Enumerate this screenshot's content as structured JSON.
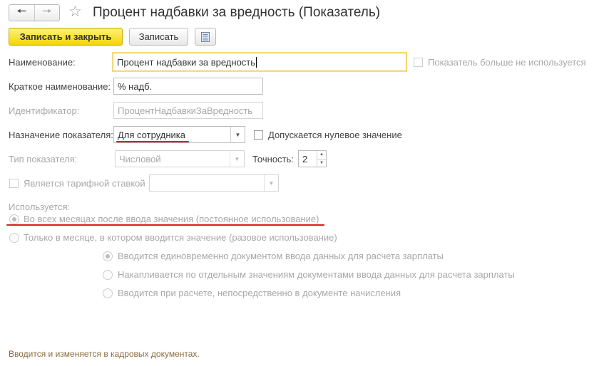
{
  "header": {
    "back_icon": "arrow-left-icon",
    "forward_icon": "arrow-right-icon",
    "favorite_icon": "star-icon",
    "title": "Процент надбавки за вредность (Показатель)"
  },
  "toolbar": {
    "save_close_label": "Записать и закрыть",
    "save_label": "Записать",
    "more_icon": "list-icon"
  },
  "form": {
    "name_label": "Наименование:",
    "name_value": "Процент надбавки за вредность",
    "unused_label": "Показатель больше не используется",
    "short_name_label": "Краткое наименование:",
    "short_name_value": "% надб.",
    "identifier_label": "Идентификатор:",
    "identifier_value": "ПроцентНадбавкиЗаВредность",
    "purpose_label": "Назначение показателя:",
    "purpose_value": "Для сотрудника",
    "zero_allowed_label": "Допускается нулевое значение",
    "type_label": "Тип показателя:",
    "type_value": "Числовой",
    "precision_label": "Точность:",
    "precision_value": "2",
    "tariff_label": "Является тарифной ставкой",
    "tariff_value": "",
    "used_label": "Используется:",
    "radio_all_months": "Во всех месяцах после ввода значения (постоянное использование)",
    "radio_one_month": "Только в месяце, в котором вводится значение (разовое использование)",
    "sub_option_1": "Вводится единовременно документом ввода данных для расчета зарплаты",
    "sub_option_2": "Накапливается по отдельным значениям документами ввода данных для расчета зарплаты",
    "sub_option_3": "Вводится при расчете, непосредственно в документе начисления"
  },
  "footer": {
    "note": "Вводится и изменяется в кадровых документах."
  },
  "colors": {
    "primary_button": "#f4d500",
    "annotation_red": "#d81e1e",
    "footer_text": "#8a6d3b",
    "focus_border": "#f2c94c"
  }
}
